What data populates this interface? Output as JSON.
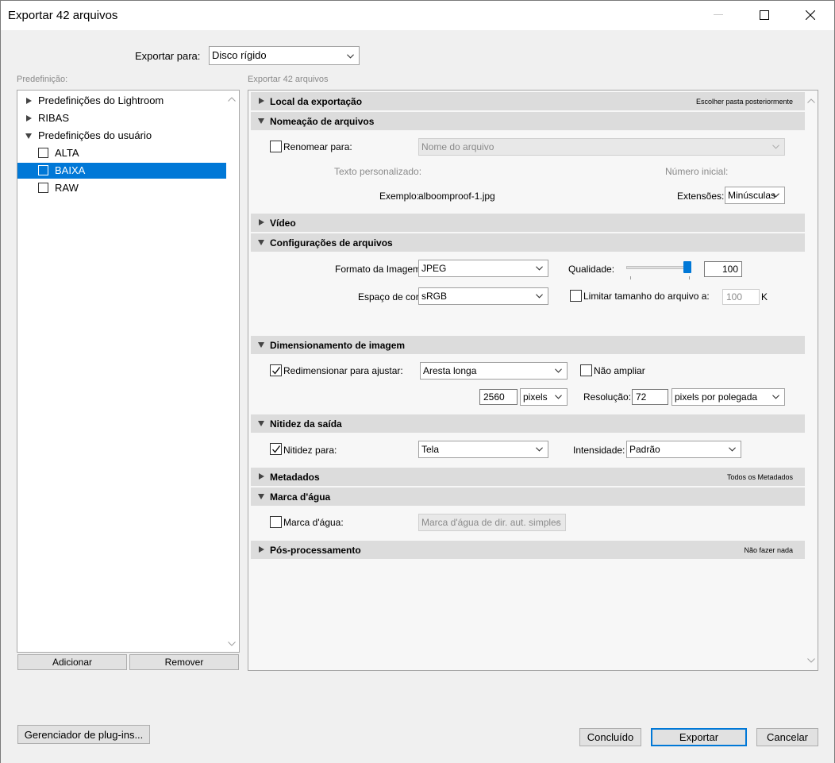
{
  "window": {
    "title": "Exportar 42 arquivos"
  },
  "export_to": {
    "label": "Exportar para:",
    "value": "Disco rígido"
  },
  "presets": {
    "label": "Predefinição:",
    "items": [
      {
        "label": "Predefinições do Lightroom",
        "expanded": false,
        "level": 0
      },
      {
        "label": "RIBAS",
        "expanded": false,
        "level": 0
      },
      {
        "label": "Predefinições do usuário",
        "expanded": true,
        "level": 0
      },
      {
        "label": "ALTA",
        "level": 1,
        "checked": false
      },
      {
        "label": "BAIXA",
        "level": 1,
        "checked": false,
        "selected": true
      },
      {
        "label": "RAW",
        "level": 1,
        "checked": false
      }
    ],
    "add_button": "Adicionar",
    "remove_button": "Remover"
  },
  "panel": {
    "header": "Exportar 42 arquivos",
    "sections": {
      "location": {
        "title": "Local da exportação",
        "right": "Escolher pasta posteriormente",
        "expanded": false
      },
      "naming": {
        "title": "Nomeação de arquivos",
        "expanded": true,
        "rename_label": "Renomear para:",
        "rename_checked": false,
        "rename_value": "Nome do arquivo",
        "custom_text_label": "Texto personalizado:",
        "start_number_label": "Número inicial:",
        "example_label": "Exemplo:",
        "example_value": "alboomproof-1.jpg",
        "extensions_label": "Extensões:",
        "extensions_value": "Minúsculas"
      },
      "video": {
        "title": "Vídeo",
        "expanded": false
      },
      "file_settings": {
        "title": "Configurações de arquivos",
        "expanded": true,
        "format_label": "Formato da Imagem:",
        "format_value": "JPEG",
        "quality_label": "Qualidade:",
        "quality_value": "100",
        "quality_fraction": 1.0,
        "colorspace_label": "Espaço de cor:",
        "colorspace_value": "sRGB",
        "limit_label": "Limitar tamanho do arquivo a:",
        "limit_checked": false,
        "limit_value": "100",
        "limit_unit": "K"
      },
      "sizing": {
        "title": "Dimensionamento de imagem",
        "expanded": true,
        "resize_label": "Redimensionar para ajustar:",
        "resize_checked": true,
        "resize_value": "Aresta longa",
        "no_enlarge_label": "Não ampliar",
        "no_enlarge_checked": false,
        "size_value": "2560",
        "size_unit": "pixels",
        "resolution_label": "Resolução:",
        "resolution_value": "72",
        "resolution_unit": "pixels por polegada"
      },
      "sharpening": {
        "title": "Nitidez da saída",
        "expanded": true,
        "sharpen_label": "Nitidez para:",
        "sharpen_checked": true,
        "sharpen_value": "Tela",
        "amount_label": "Intensidade:",
        "amount_value": "Padrão"
      },
      "metadata": {
        "title": "Metadados",
        "right": "Todos os Metadados",
        "expanded": false
      },
      "watermark": {
        "title": "Marca d'água",
        "expanded": true,
        "watermark_label": "Marca d'água:",
        "watermark_checked": false,
        "watermark_value": "Marca d'água de dir. aut. simples"
      },
      "post": {
        "title": "Pós-processamento",
        "right": "Não fazer nada",
        "expanded": false
      }
    }
  },
  "footer": {
    "plugin_manager": "Gerenciador de plug-ins...",
    "done": "Concluído",
    "export": "Exportar",
    "cancel": "Cancelar"
  },
  "colors": {
    "selection": "#0078d7",
    "section_header": "#dcdcdc",
    "slider_thumb": "#0078d7"
  }
}
